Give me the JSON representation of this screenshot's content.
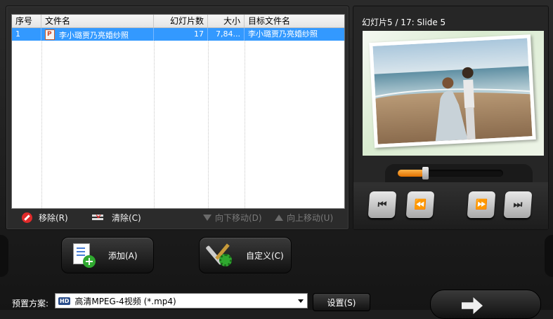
{
  "file_list": {
    "columns": {
      "index": "序号",
      "name": "文件名",
      "slides": "幻灯片数",
      "size": "大小",
      "target": "目标文件名"
    },
    "rows": [
      {
        "index": "1",
        "name": "李小璐贾乃亮婚纱照",
        "slides": "17",
        "size": "7,84...",
        "target": "李小璐贾乃亮婚纱照",
        "selected": true
      }
    ]
  },
  "list_actions": {
    "remove": "移除(R)",
    "clear": "清除(C)",
    "move_down": "向下移动(D)",
    "move_up": "向上移动(U)"
  },
  "preview": {
    "slide_label": "幻灯片5 / 17: Slide 5",
    "seek_position_fraction": 0.26
  },
  "player_icons": [
    "skip-to-start-icon",
    "rewind-icon",
    "fast-forward-icon",
    "skip-to-end-icon"
  ],
  "buttons": {
    "add": "添加(A)",
    "custom": "自定义(C)",
    "settings": "设置(S)"
  },
  "preset": {
    "label": "预置方案:",
    "badge": "HD",
    "value": "高清MPEG-4视频 (*.mp4)"
  },
  "colors": {
    "selection": "#3399ff",
    "remove_icon": "#e02a2a",
    "seek_fill": "#f08a1c"
  }
}
